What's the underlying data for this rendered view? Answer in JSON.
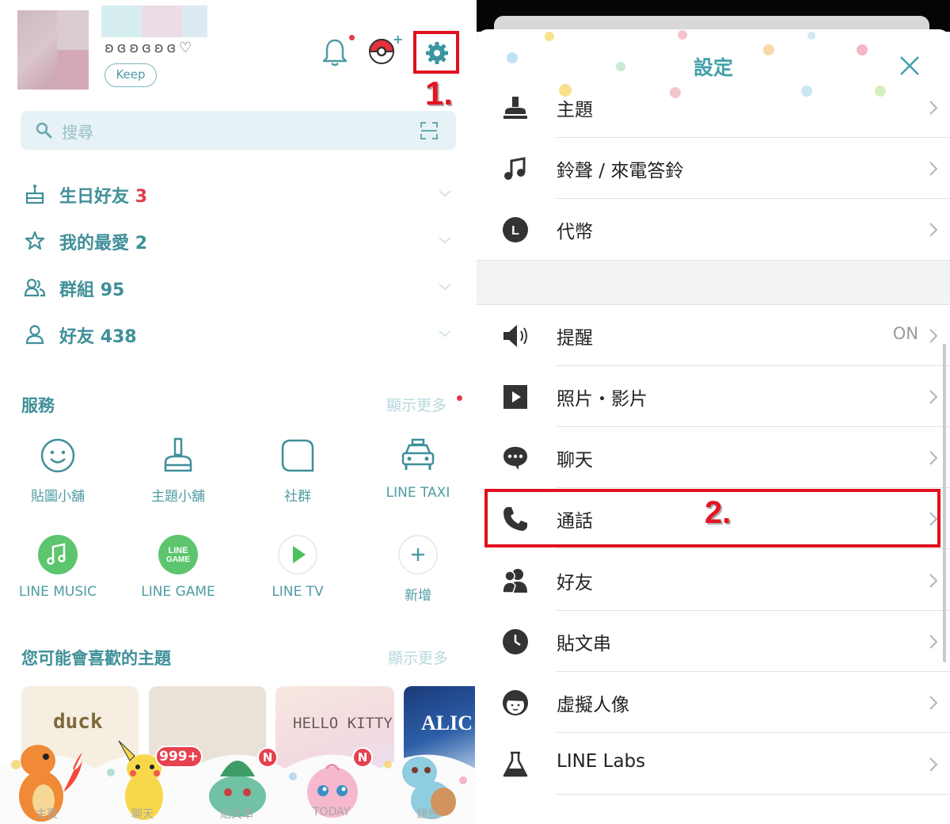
{
  "left": {
    "profile": {
      "name_deco": "ʚ ɞ ʚ ɞ ʚ ɞ ♡",
      "keep_label": "Keep"
    },
    "step1_label": "1.",
    "search": {
      "placeholder": "搜尋"
    },
    "friend_rows": [
      {
        "label": "生日好友",
        "count": "3",
        "count_red": true,
        "icon": "cake-icon"
      },
      {
        "label": "我的最愛",
        "count": "2",
        "icon": "star-icon"
      },
      {
        "label": "群組",
        "count": "95",
        "icon": "group-icon"
      },
      {
        "label": "好友",
        "count": "438",
        "icon": "person-icon"
      }
    ],
    "services": {
      "title": "服務",
      "show_more": "顯示更多",
      "items": [
        {
          "label": "貼圖小舖",
          "icon": "smiley-icon"
        },
        {
          "label": "主題小舖",
          "icon": "brush-icon"
        },
        {
          "label": "社群",
          "icon": "square-chat-icon"
        },
        {
          "label": "LINE TAXI",
          "icon": "taxi-icon"
        },
        {
          "label": "LINE MUSIC",
          "icon": "music-icon"
        },
        {
          "label": "LINE GAME",
          "icon": "game-icon",
          "icon_text": "LINE GAME"
        },
        {
          "label": "LINE TV",
          "icon": "play-icon"
        },
        {
          "label": "新增",
          "icon": "plus-icon"
        }
      ]
    },
    "themes": {
      "title": "您可能會喜歡的主題",
      "show_more": "顯示更多",
      "cards": [
        {
          "text": "duck"
        },
        {
          "text": ""
        },
        {
          "text": "HELLO KITTY"
        },
        {
          "text": "ALIC"
        }
      ]
    },
    "bottom_nav": [
      {
        "label": "主頁"
      },
      {
        "label": "聊天",
        "badge": "999+"
      },
      {
        "label": "貼文串",
        "badge": "N"
      },
      {
        "label": "TODAY",
        "badge": "N"
      },
      {
        "label": "錢包"
      }
    ],
    "colors": {
      "teal": "#3f8f99",
      "red": "#e01020",
      "green": "#5dc56d"
    }
  },
  "right": {
    "title": "設定",
    "step2_label": "2.",
    "rows_top": [
      {
        "label": "主題",
        "icon": "brush-icon"
      },
      {
        "label": "鈴聲 / 來電答鈴",
        "icon": "music-note-icon"
      },
      {
        "label": "代幣",
        "icon": "coin-icon",
        "icon_text": "L"
      }
    ],
    "rows_bottom": [
      {
        "label": "提醒",
        "value": "ON",
        "icon": "speaker-icon"
      },
      {
        "label": "照片・影片",
        "icon": "play-box-icon"
      },
      {
        "label": "聊天",
        "icon": "chat-bubble-icon"
      },
      {
        "label": "通話",
        "icon": "phone-icon"
      },
      {
        "label": "好友",
        "icon": "friends-icon"
      },
      {
        "label": "貼文串",
        "icon": "clock-icon"
      },
      {
        "label": "虛擬人像",
        "icon": "avatar-face-icon"
      },
      {
        "label": "LINE Labs",
        "icon": "flask-icon"
      }
    ]
  }
}
